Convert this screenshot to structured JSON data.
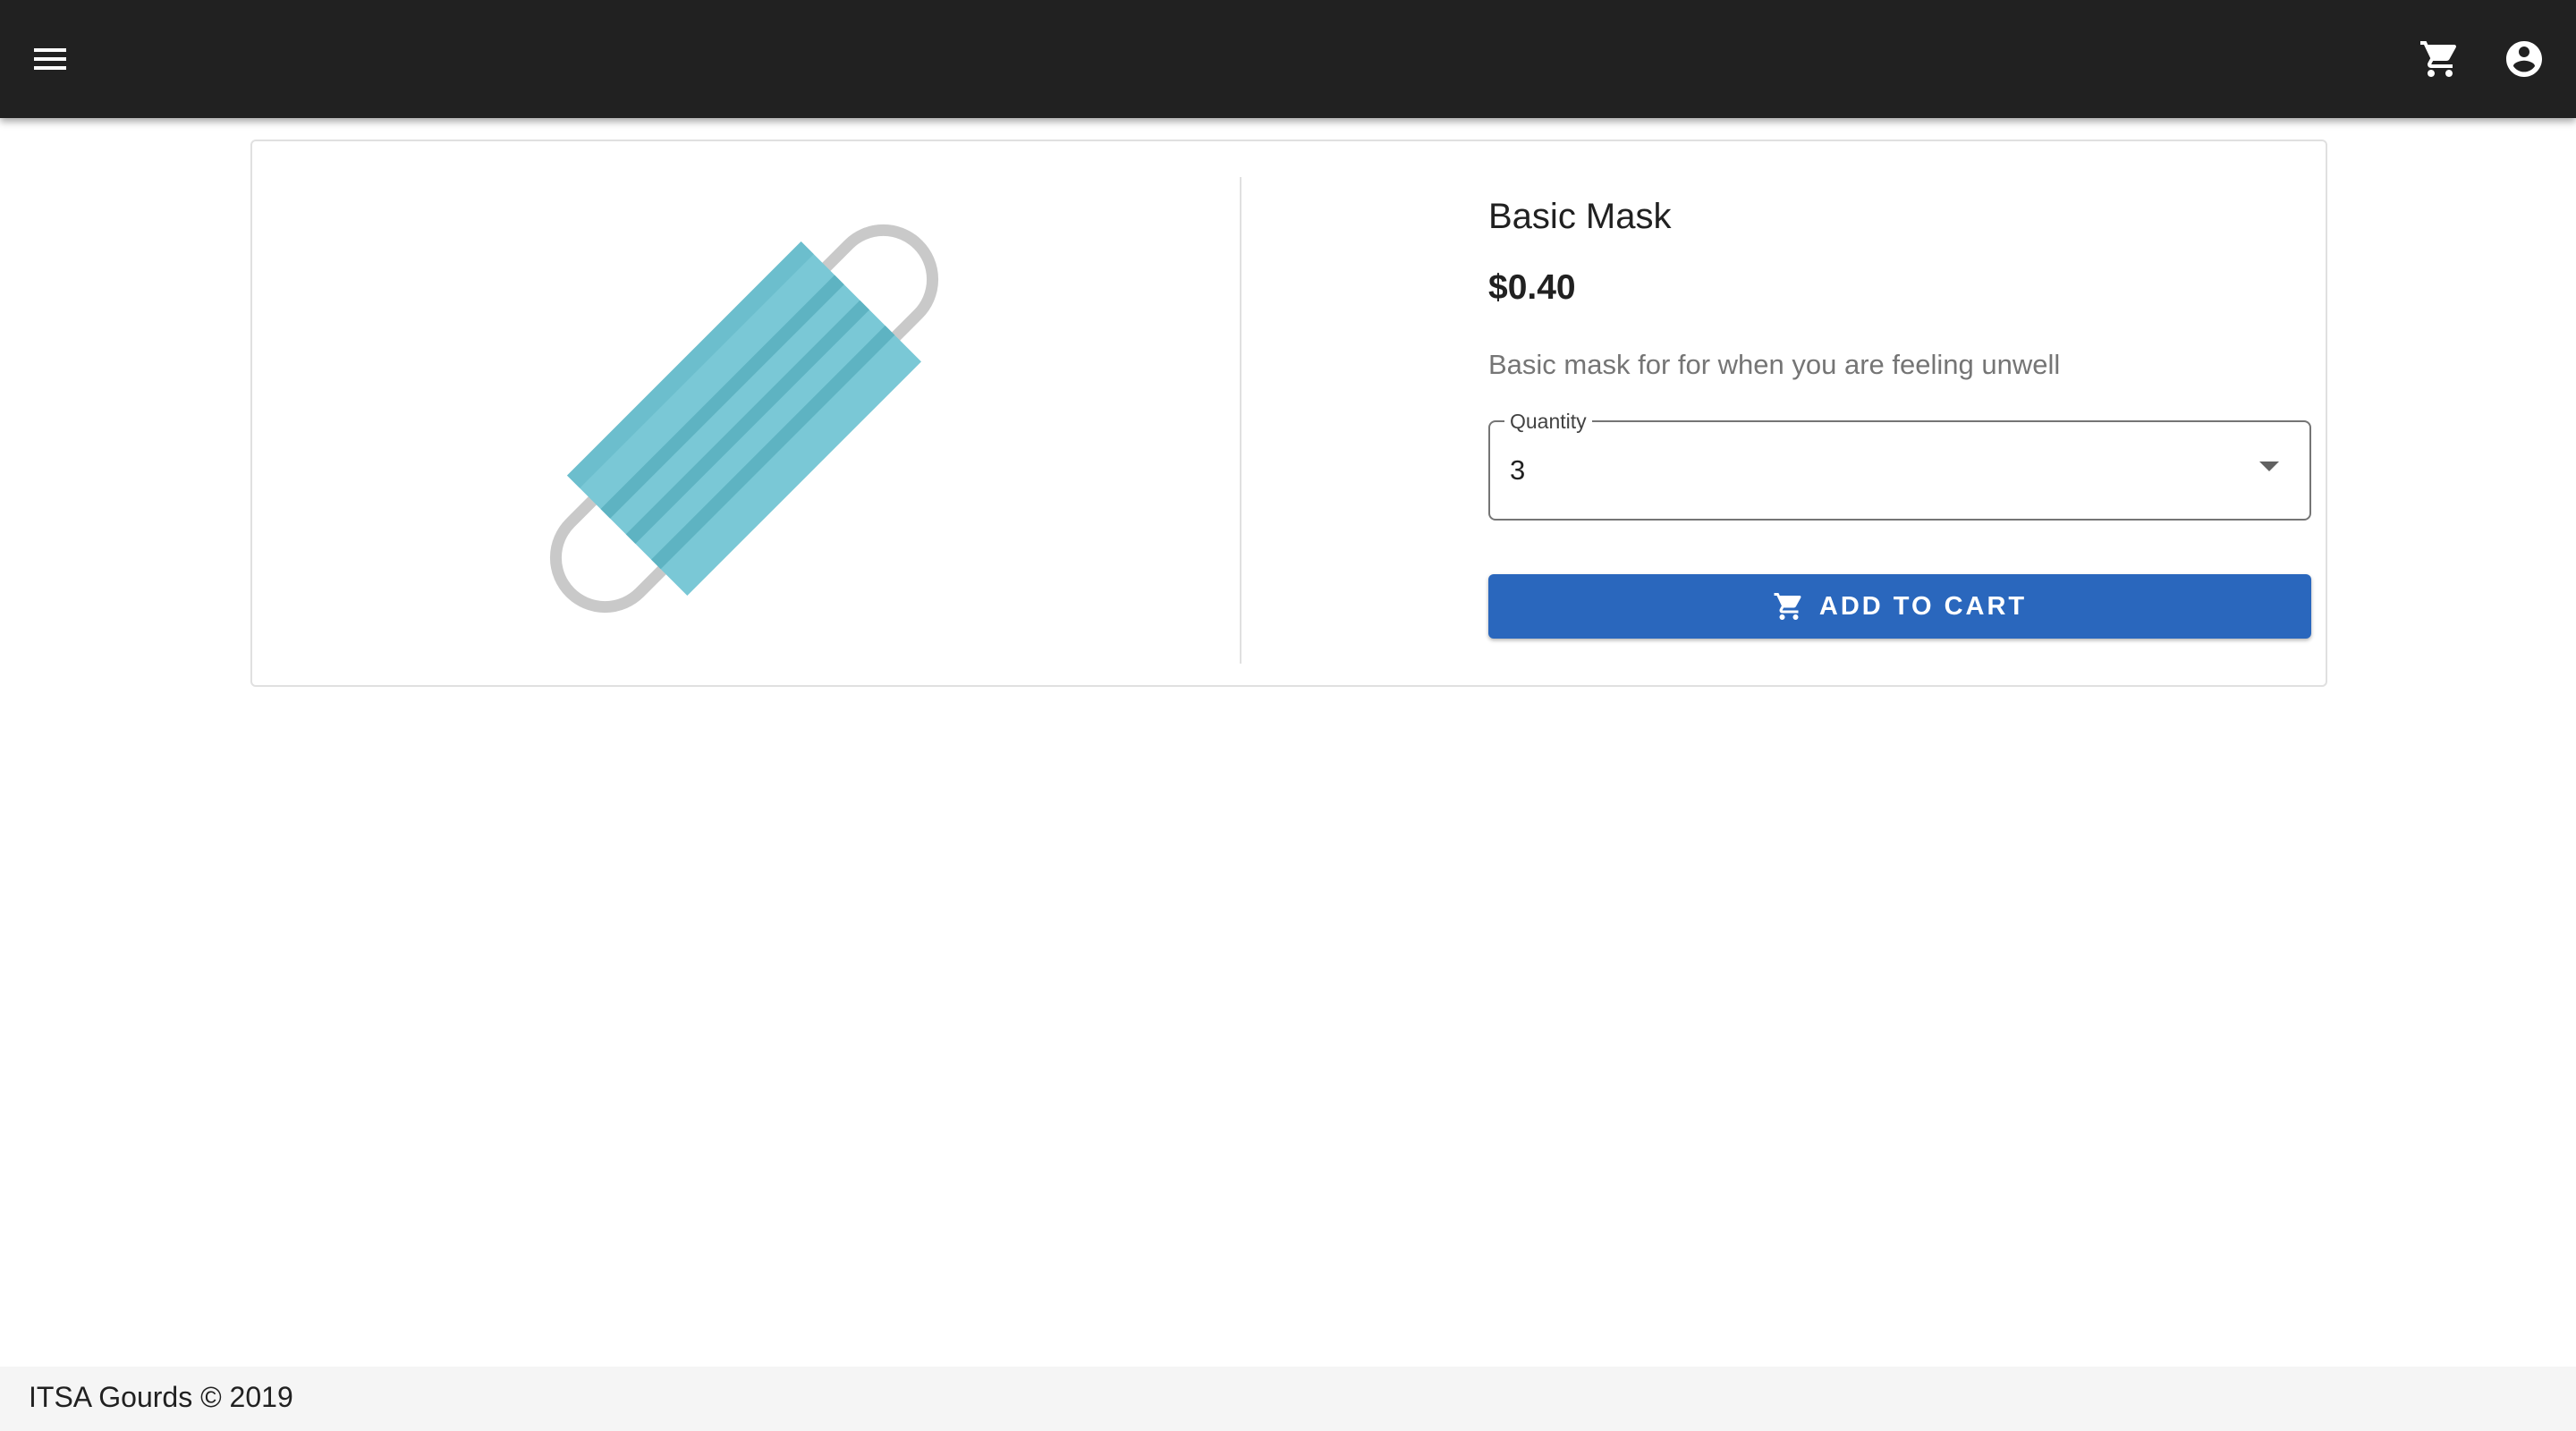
{
  "header": {
    "menu_icon": "menu-icon",
    "cart_icon": "shopping-cart-icon",
    "account_icon": "account-circle-icon",
    "background": "#212121"
  },
  "product": {
    "name": "Basic Mask",
    "price": "$0.40",
    "description": "Basic mask for for when you are feeling unwell",
    "image_icon": "face-mask-image",
    "quantity": {
      "label": "Quantity",
      "value": "3"
    },
    "add_button_label": "ADD TO CART",
    "add_button_icon": "shopping-cart-icon",
    "accent": "#2a67bd"
  },
  "footer": {
    "text": "ITSA Gourds © 2019"
  }
}
